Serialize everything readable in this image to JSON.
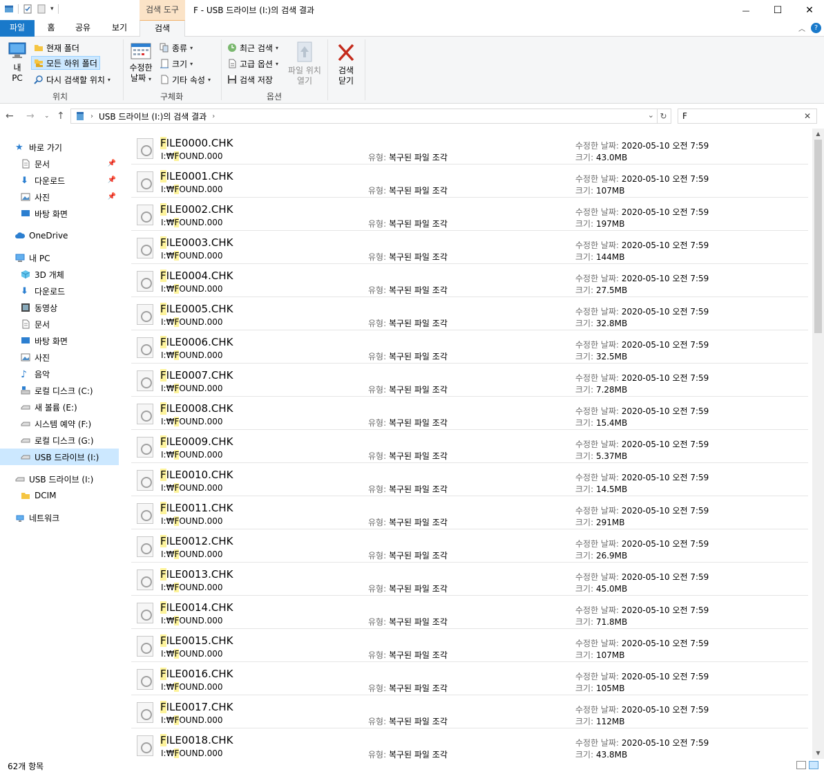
{
  "window": {
    "title": "F - USB 드라이브 (I:)의 검색 결과",
    "context_tool": "검색 도구",
    "minimize": "—",
    "maximize": "☐",
    "close": "✕"
  },
  "ribbon_tabs": [
    {
      "label": "파일"
    },
    {
      "label": "홈"
    },
    {
      "label": "공유"
    },
    {
      "label": "보기"
    },
    {
      "label": "검색"
    }
  ],
  "ribbon": {
    "location": {
      "this_pc_line1": "내",
      "this_pc_line2": "PC",
      "current_folder": "현재 폴더",
      "all_subfolders": "모든 하위 폴더",
      "search_again": "다시 검색할 위치",
      "group_label": "위치"
    },
    "refine": {
      "date_modified_line1": "수정한",
      "date_modified_line2": "날짜",
      "kind": "종류",
      "size": "크기",
      "other_props": "기타 속성",
      "group_label": "구체화"
    },
    "options": {
      "recent_searches": "최근 검색",
      "advanced_options": "고급 옵션",
      "save_search": "검색 저장",
      "open_file_location_line1": "파일 위치",
      "open_file_location_line2": "열기",
      "group_label": "옵션"
    },
    "close_search_line1": "검색",
    "close_search_line2": "닫기"
  },
  "address": {
    "path": "USB 드라이브 (I:)의 검색 결과",
    "search_value": "F"
  },
  "sidebar": {
    "quick_access": "바로 가기",
    "qa_items": [
      "문서",
      "다운로드",
      "사진",
      "바탕 화면"
    ],
    "onedrive": "OneDrive",
    "this_pc": "내 PC",
    "pc_items": [
      "3D 개체",
      "다운로드",
      "동영상",
      "문서",
      "바탕 화면",
      "사진",
      "음악",
      "로컬 디스크 (C:)",
      "새 볼륨 (E:)",
      "시스템 예약 (F:)",
      "로컬 디스크 (G:)",
      "USB 드라이브 (I:)"
    ],
    "usb": "USB 드라이브 (I:)",
    "dcim": "DCIM",
    "network": "네트워크"
  },
  "labels": {
    "type": "유형:",
    "date": "수정한 날짜:",
    "size": "크기:"
  },
  "files": [
    {
      "hl": "F",
      "rest": "ILE0000.CHK",
      "path_a": "I:₩",
      "path_hl": "F",
      "path_b": "OUND.000",
      "type": "복구된 파일 조각",
      "date": "2020-05-10 오전 7:59",
      "size": "43.0MB"
    },
    {
      "hl": "F",
      "rest": "ILE0001.CHK",
      "path_a": "I:₩",
      "path_hl": "F",
      "path_b": "OUND.000",
      "type": "복구된 파일 조각",
      "date": "2020-05-10 오전 7:59",
      "size": "107MB"
    },
    {
      "hl": "F",
      "rest": "ILE0002.CHK",
      "path_a": "I:₩",
      "path_hl": "F",
      "path_b": "OUND.000",
      "type": "복구된 파일 조각",
      "date": "2020-05-10 오전 7:59",
      "size": "197MB"
    },
    {
      "hl": "F",
      "rest": "ILE0003.CHK",
      "path_a": "I:₩",
      "path_hl": "F",
      "path_b": "OUND.000",
      "type": "복구된 파일 조각",
      "date": "2020-05-10 오전 7:59",
      "size": "144MB"
    },
    {
      "hl": "F",
      "rest": "ILE0004.CHK",
      "path_a": "I:₩",
      "path_hl": "F",
      "path_b": "OUND.000",
      "type": "복구된 파일 조각",
      "date": "2020-05-10 오전 7:59",
      "size": "27.5MB"
    },
    {
      "hl": "F",
      "rest": "ILE0005.CHK",
      "path_a": "I:₩",
      "path_hl": "F",
      "path_b": "OUND.000",
      "type": "복구된 파일 조각",
      "date": "2020-05-10 오전 7:59",
      "size": "32.8MB"
    },
    {
      "hl": "F",
      "rest": "ILE0006.CHK",
      "path_a": "I:₩",
      "path_hl": "F",
      "path_b": "OUND.000",
      "type": "복구된 파일 조각",
      "date": "2020-05-10 오전 7:59",
      "size": "32.5MB"
    },
    {
      "hl": "F",
      "rest": "ILE0007.CHK",
      "path_a": "I:₩",
      "path_hl": "F",
      "path_b": "OUND.000",
      "type": "복구된 파일 조각",
      "date": "2020-05-10 오전 7:59",
      "size": "7.28MB"
    },
    {
      "hl": "F",
      "rest": "ILE0008.CHK",
      "path_a": "I:₩",
      "path_hl": "F",
      "path_b": "OUND.000",
      "type": "복구된 파일 조각",
      "date": "2020-05-10 오전 7:59",
      "size": "15.4MB"
    },
    {
      "hl": "F",
      "rest": "ILE0009.CHK",
      "path_a": "I:₩",
      "path_hl": "F",
      "path_b": "OUND.000",
      "type": "복구된 파일 조각",
      "date": "2020-05-10 오전 7:59",
      "size": "5.37MB"
    },
    {
      "hl": "F",
      "rest": "ILE0010.CHK",
      "path_a": "I:₩",
      "path_hl": "F",
      "path_b": "OUND.000",
      "type": "복구된 파일 조각",
      "date": "2020-05-10 오전 7:59",
      "size": "14.5MB"
    },
    {
      "hl": "F",
      "rest": "ILE0011.CHK",
      "path_a": "I:₩",
      "path_hl": "F",
      "path_b": "OUND.000",
      "type": "복구된 파일 조각",
      "date": "2020-05-10 오전 7:59",
      "size": "291MB"
    },
    {
      "hl": "F",
      "rest": "ILE0012.CHK",
      "path_a": "I:₩",
      "path_hl": "F",
      "path_b": "OUND.000",
      "type": "복구된 파일 조각",
      "date": "2020-05-10 오전 7:59",
      "size": "26.9MB"
    },
    {
      "hl": "F",
      "rest": "ILE0013.CHK",
      "path_a": "I:₩",
      "path_hl": "F",
      "path_b": "OUND.000",
      "type": "복구된 파일 조각",
      "date": "2020-05-10 오전 7:59",
      "size": "45.0MB"
    },
    {
      "hl": "F",
      "rest": "ILE0014.CHK",
      "path_a": "I:₩",
      "path_hl": "F",
      "path_b": "OUND.000",
      "type": "복구된 파일 조각",
      "date": "2020-05-10 오전 7:59",
      "size": "71.8MB"
    },
    {
      "hl": "F",
      "rest": "ILE0015.CHK",
      "path_a": "I:₩",
      "path_hl": "F",
      "path_b": "OUND.000",
      "type": "복구된 파일 조각",
      "date": "2020-05-10 오전 7:59",
      "size": "107MB"
    },
    {
      "hl": "F",
      "rest": "ILE0016.CHK",
      "path_a": "I:₩",
      "path_hl": "F",
      "path_b": "OUND.000",
      "type": "복구된 파일 조각",
      "date": "2020-05-10 오전 7:59",
      "size": "105MB"
    },
    {
      "hl": "F",
      "rest": "ILE0017.CHK",
      "path_a": "I:₩",
      "path_hl": "F",
      "path_b": "OUND.000",
      "type": "복구된 파일 조각",
      "date": "2020-05-10 오전 7:59",
      "size": "112MB"
    },
    {
      "hl": "F",
      "rest": "ILE0018.CHK",
      "path_a": "I:₩",
      "path_hl": "F",
      "path_b": "OUND.000",
      "type": "복구된 파일 조각",
      "date": "2020-05-10 오전 7:59",
      "size": "43.8MB"
    }
  ],
  "status": {
    "count": "62개 항목"
  },
  "colors": {
    "accent": "#1979ca",
    "highlight": "#fdf39b",
    "context_tab": "#fbe3c7",
    "close_x": "#c42b1c"
  }
}
